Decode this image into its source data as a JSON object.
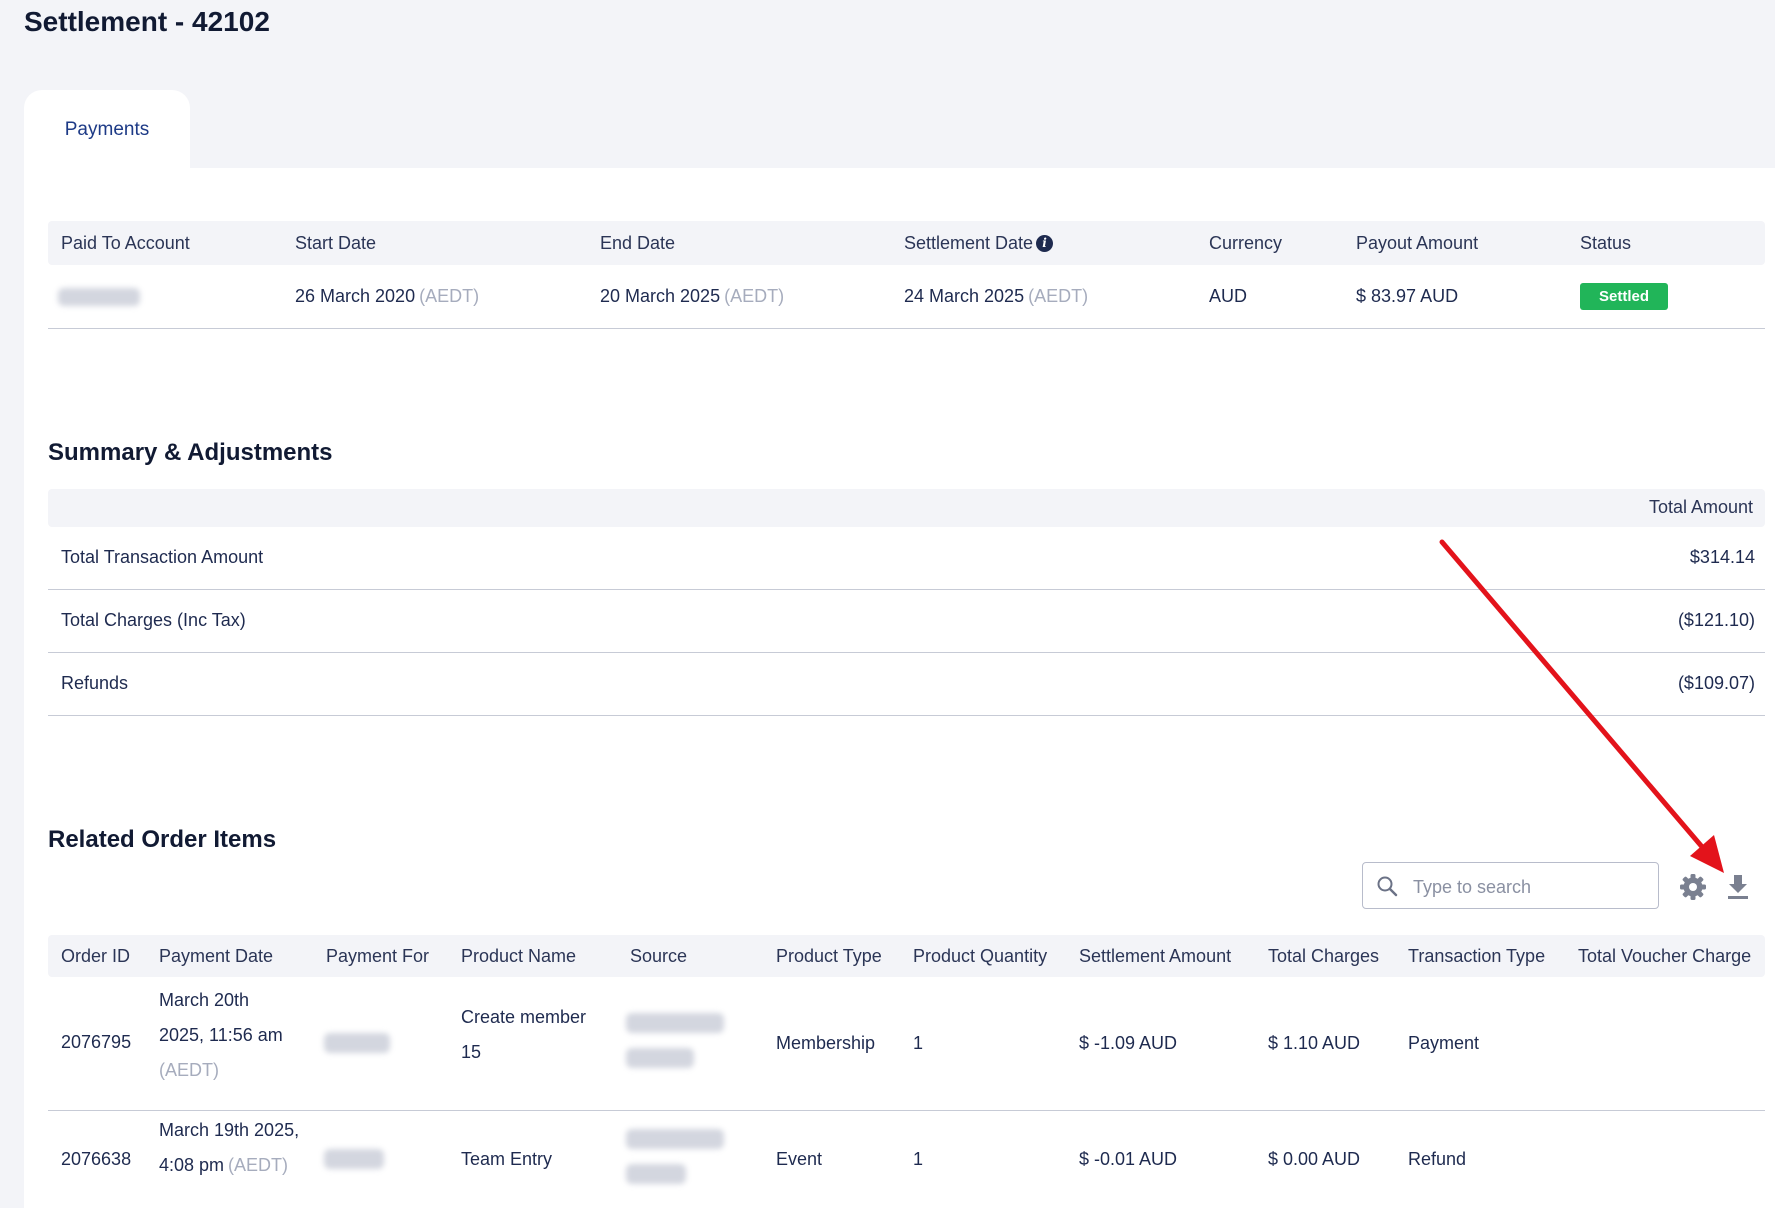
{
  "page": {
    "title": "Settlement - 42102",
    "tab_label": "Payments"
  },
  "payments": {
    "headers": [
      "Paid To Account",
      "Start Date",
      "End Date",
      "Settlement Date",
      "Currency",
      "Payout Amount",
      "Status"
    ],
    "row": {
      "start_date": "26 March 2020",
      "end_date": "20 March 2025",
      "settlement_date": "24 March 2025",
      "timezone": "(AEDT)",
      "currency": "AUD",
      "payout_amount": "$ 83.97 AUD",
      "status": "Settled"
    }
  },
  "summary": {
    "title": "Summary & Adjustments",
    "header": "Total Amount",
    "rows": [
      {
        "label": "Total Transaction Amount",
        "value": "$314.14"
      },
      {
        "label": "Total Charges (Inc Tax)",
        "value": "($121.10)"
      },
      {
        "label": "Refunds",
        "value": "($109.07)"
      }
    ]
  },
  "orders": {
    "title": "Related Order Items",
    "search_placeholder": "Type to search",
    "headers": [
      "Order ID",
      "Payment Date",
      "Payment For",
      "Product Name",
      "Source",
      "Product Type",
      "Product Quantity",
      "Settlement Amount",
      "Total Charges",
      "Transaction Type",
      "Total Voucher Charge"
    ],
    "rows": [
      {
        "order_id": "2076795",
        "payment_date_line1": "March 20th",
        "payment_date_line2": "2025, 11:56 am",
        "timezone": "(AEDT)",
        "product_name_line1": "Create member",
        "product_name_line2": "15",
        "product_type": "Membership",
        "quantity": "1",
        "settlement_amount": "$ -1.09 AUD",
        "total_charges": "$ 1.10 AUD",
        "transaction_type": "Payment"
      },
      {
        "order_id": "2076638",
        "payment_date_line1": "March 19th 2025,",
        "payment_date_line2": "4:08 pm",
        "timezone": "(AEDT)",
        "product_name": "Team Entry",
        "product_type": "Event",
        "quantity": "1",
        "settlement_amount": "$ -0.01 AUD",
        "total_charges": "$ 0.00 AUD",
        "transaction_type": "Refund"
      }
    ]
  },
  "colors": {
    "background": "#f3f4f8",
    "settled_badge": "#21b559",
    "annotation_arrow": "#e3131b",
    "tab_text": "#1d3a86"
  },
  "icons": [
    "info-icon",
    "search-icon",
    "gear-icon",
    "download-icon"
  ]
}
